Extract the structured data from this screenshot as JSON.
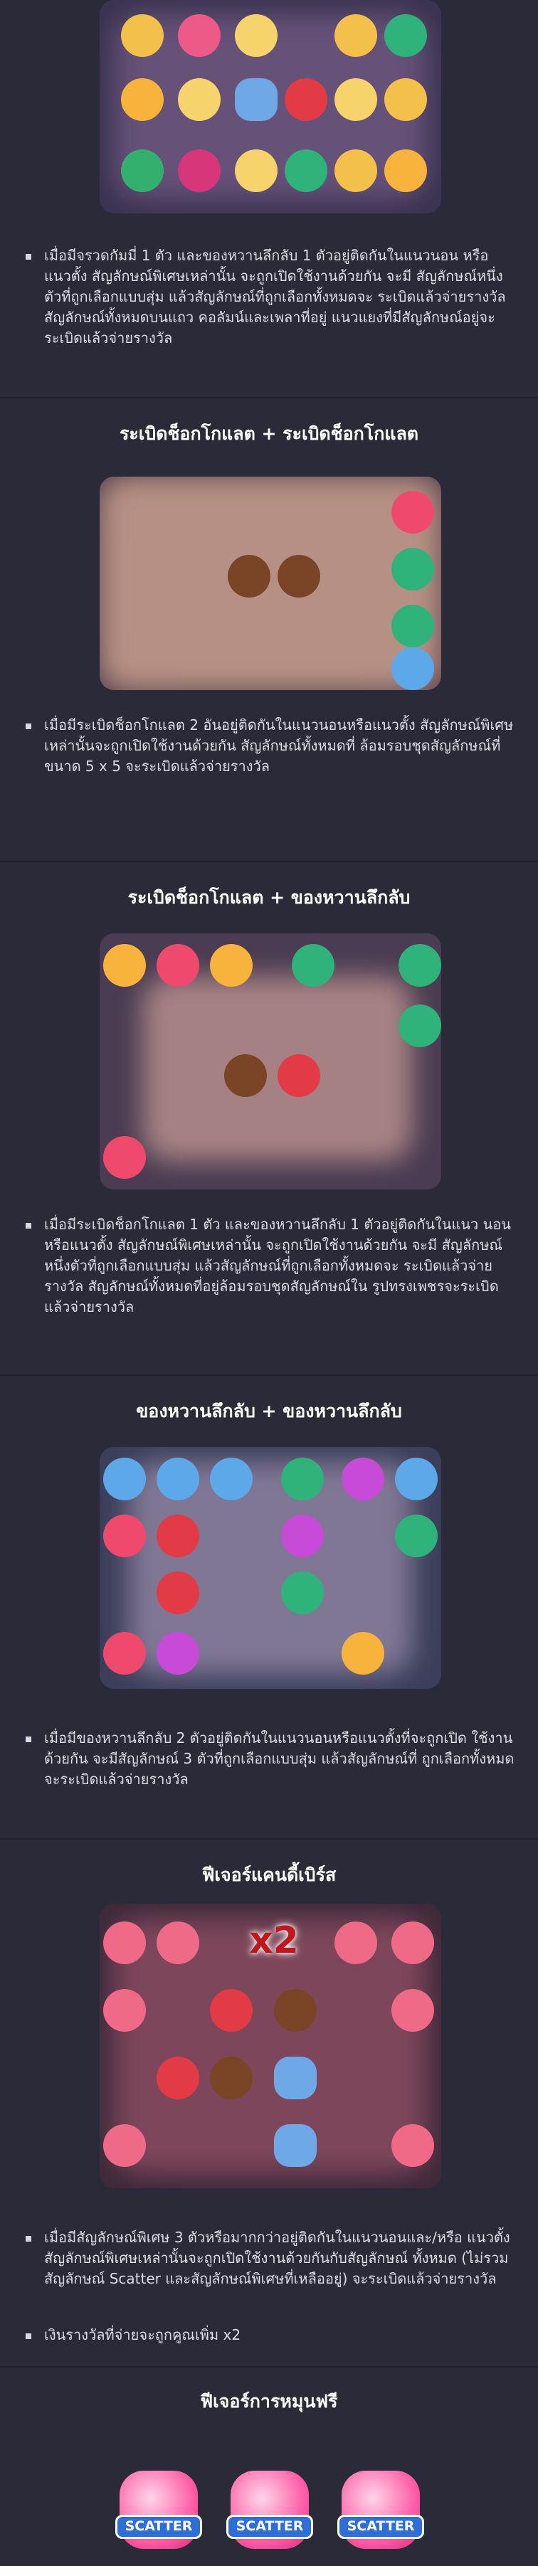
{
  "sections": [
    {
      "title": "",
      "bullets": [
        "เมื่อมีจรวดกัมมี่ 1 ตัว และของหวานลึกลับ 1 ตัวอยู่ติดกันในแนวนอน หรือแนวตั้ง สัญลักษณ์พิเศษเหล่านั้น จะถูกเปิดใช้งานด้วยกัน จะมี สัญลักษณ์หนึ่งตัวที่ถูกเลือกแบบสุ่ม แล้วสัญลักษณ์ที่ถูกเลือกทั้งหมดจะ ระเบิดแล้วจ่ายรางวัล สัญลักษณ์ทั้งหมดบนแถว คอลัมน์และเพลาที่อยู่ แนวแยงที่มีสัญลักษณ์อยู่จะระเบิดแล้วจ่ายรางวัล"
      ]
    },
    {
      "title": "ระเบิดช็อกโกแลต + ระเบิดช็อกโกแลต",
      "bullets": [
        "เมื่อมีระเบิดช็อกโกแลต 2 อันอยู่ติดกันในแนวนอนหรือแนวตั้ง สัญลักษณ์พิเศษเหล่านั้นจะถูกเปิดใช้งานด้วยกัน สัญลักษณ์ทั้งหมดที่ ล้อมรอบชุดสัญลักษณ์ที่ขนาด 5 x 5 จะระเบิดแล้วจ่ายรางวัล"
      ]
    },
    {
      "title": "ระเบิดช็อกโกแลต + ของหวานลึกลับ",
      "bullets": [
        "เมื่อมีระเบิดช็อกโกแลต 1 ตัว และของหวานลึกลับ 1 ตัวอยู่ติดกันในแนว นอนหรือแนวตั้ง สัญลักษณ์พิเศษเหล่านั้น จะถูกเปิดใช้งานด้วยกัน จะมี สัญลักษณ์หนึ่งตัวที่ถูกเลือกแบบสุ่ม แล้วสัญลักษณ์ที่ถูกเลือกทั้งหมดจะ ระเบิดแล้วจ่ายรางวัล สัญลักษณ์ทั้งหมดที่อยู่ล้อมรอบชุดสัญลักษณ์ใน รูปทรงเพชรจะระเบิดแล้วจ่ายรางวัล"
      ]
    },
    {
      "title": "ของหวานลึกลับ + ของหวานลึกลับ",
      "bullets": [
        "เมื่อมีของหวานลึกลับ 2 ตัวอยู่ติดกันในแนวนอนหรือแนวตั้งที่จะถูกเปิด ใช้งานด้วยกัน จะมีสัญลักษณ์ 3 ตัวที่ถูกเลือกแบบสุ่ม แล้วสัญลักษณ์ที่ ถูกเลือกทั้งหมดจะระเบิดแล้วจ่ายรางวัล"
      ]
    },
    {
      "title": "ฟีเจอร์แคนดี้เบิร์ส",
      "badge": "x2",
      "bullets": [
        "เมื่อมีสัญลักษณ์พิเศษ 3 ตัวหรือมากกว่าอยู่ติดกันในแนวนอนและ/หรือ แนวตั้ง สัญลักษณ์พิเศษเหล่านั้นจะถูกเปิดใช้งานด้วยกันกับสัญลักษณ์ ทั้งหมด (ไม่รวมสัญลักษณ์ Scatter และสัญลักษณ์พิเศษที่เหลืออยู่) จะระเบิดแล้วจ่ายรางวัล",
        "เงินรางวัลที่จ่ายจะถูกคูณเพิ่ม x2"
      ]
    },
    {
      "title": "ฟีเจอร์การหมุนฟรี",
      "scatter_label": "SCATTER"
    }
  ],
  "colors": {
    "background": "#2a2a38",
    "separator": "#22222e",
    "title": "#ffffff",
    "text": "#dcdce6"
  }
}
